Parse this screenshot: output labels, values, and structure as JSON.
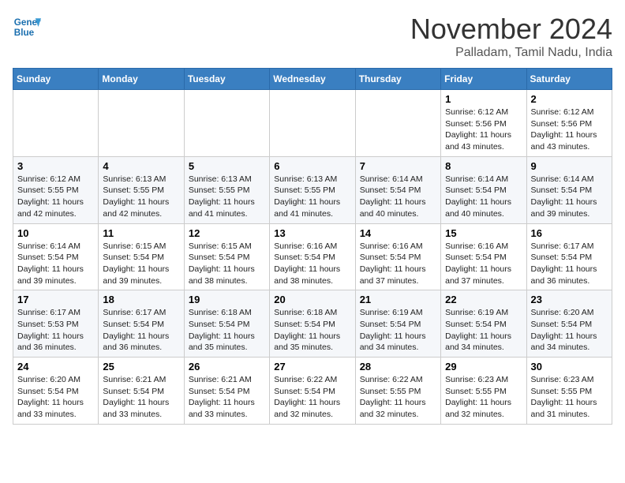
{
  "header": {
    "logo_line1": "General",
    "logo_line2": "Blue",
    "month": "November 2024",
    "location": "Palladam, Tamil Nadu, India"
  },
  "weekdays": [
    "Sunday",
    "Monday",
    "Tuesday",
    "Wednesday",
    "Thursday",
    "Friday",
    "Saturday"
  ],
  "weeks": [
    [
      {
        "day": "",
        "info": ""
      },
      {
        "day": "",
        "info": ""
      },
      {
        "day": "",
        "info": ""
      },
      {
        "day": "",
        "info": ""
      },
      {
        "day": "",
        "info": ""
      },
      {
        "day": "1",
        "info": "Sunrise: 6:12 AM\nSunset: 5:56 PM\nDaylight: 11 hours\nand 43 minutes."
      },
      {
        "day": "2",
        "info": "Sunrise: 6:12 AM\nSunset: 5:56 PM\nDaylight: 11 hours\nand 43 minutes."
      }
    ],
    [
      {
        "day": "3",
        "info": "Sunrise: 6:12 AM\nSunset: 5:55 PM\nDaylight: 11 hours\nand 42 minutes."
      },
      {
        "day": "4",
        "info": "Sunrise: 6:13 AM\nSunset: 5:55 PM\nDaylight: 11 hours\nand 42 minutes."
      },
      {
        "day": "5",
        "info": "Sunrise: 6:13 AM\nSunset: 5:55 PM\nDaylight: 11 hours\nand 41 minutes."
      },
      {
        "day": "6",
        "info": "Sunrise: 6:13 AM\nSunset: 5:55 PM\nDaylight: 11 hours\nand 41 minutes."
      },
      {
        "day": "7",
        "info": "Sunrise: 6:14 AM\nSunset: 5:54 PM\nDaylight: 11 hours\nand 40 minutes."
      },
      {
        "day": "8",
        "info": "Sunrise: 6:14 AM\nSunset: 5:54 PM\nDaylight: 11 hours\nand 40 minutes."
      },
      {
        "day": "9",
        "info": "Sunrise: 6:14 AM\nSunset: 5:54 PM\nDaylight: 11 hours\nand 39 minutes."
      }
    ],
    [
      {
        "day": "10",
        "info": "Sunrise: 6:14 AM\nSunset: 5:54 PM\nDaylight: 11 hours\nand 39 minutes."
      },
      {
        "day": "11",
        "info": "Sunrise: 6:15 AM\nSunset: 5:54 PM\nDaylight: 11 hours\nand 39 minutes."
      },
      {
        "day": "12",
        "info": "Sunrise: 6:15 AM\nSunset: 5:54 PM\nDaylight: 11 hours\nand 38 minutes."
      },
      {
        "day": "13",
        "info": "Sunrise: 6:16 AM\nSunset: 5:54 PM\nDaylight: 11 hours\nand 38 minutes."
      },
      {
        "day": "14",
        "info": "Sunrise: 6:16 AM\nSunset: 5:54 PM\nDaylight: 11 hours\nand 37 minutes."
      },
      {
        "day": "15",
        "info": "Sunrise: 6:16 AM\nSunset: 5:54 PM\nDaylight: 11 hours\nand 37 minutes."
      },
      {
        "day": "16",
        "info": "Sunrise: 6:17 AM\nSunset: 5:54 PM\nDaylight: 11 hours\nand 36 minutes."
      }
    ],
    [
      {
        "day": "17",
        "info": "Sunrise: 6:17 AM\nSunset: 5:53 PM\nDaylight: 11 hours\nand 36 minutes."
      },
      {
        "day": "18",
        "info": "Sunrise: 6:17 AM\nSunset: 5:54 PM\nDaylight: 11 hours\nand 36 minutes."
      },
      {
        "day": "19",
        "info": "Sunrise: 6:18 AM\nSunset: 5:54 PM\nDaylight: 11 hours\nand 35 minutes."
      },
      {
        "day": "20",
        "info": "Sunrise: 6:18 AM\nSunset: 5:54 PM\nDaylight: 11 hours\nand 35 minutes."
      },
      {
        "day": "21",
        "info": "Sunrise: 6:19 AM\nSunset: 5:54 PM\nDaylight: 11 hours\nand 34 minutes."
      },
      {
        "day": "22",
        "info": "Sunrise: 6:19 AM\nSunset: 5:54 PM\nDaylight: 11 hours\nand 34 minutes."
      },
      {
        "day": "23",
        "info": "Sunrise: 6:20 AM\nSunset: 5:54 PM\nDaylight: 11 hours\nand 34 minutes."
      }
    ],
    [
      {
        "day": "24",
        "info": "Sunrise: 6:20 AM\nSunset: 5:54 PM\nDaylight: 11 hours\nand 33 minutes."
      },
      {
        "day": "25",
        "info": "Sunrise: 6:21 AM\nSunset: 5:54 PM\nDaylight: 11 hours\nand 33 minutes."
      },
      {
        "day": "26",
        "info": "Sunrise: 6:21 AM\nSunset: 5:54 PM\nDaylight: 11 hours\nand 33 minutes."
      },
      {
        "day": "27",
        "info": "Sunrise: 6:22 AM\nSunset: 5:54 PM\nDaylight: 11 hours\nand 32 minutes."
      },
      {
        "day": "28",
        "info": "Sunrise: 6:22 AM\nSunset: 5:55 PM\nDaylight: 11 hours\nand 32 minutes."
      },
      {
        "day": "29",
        "info": "Sunrise: 6:23 AM\nSunset: 5:55 PM\nDaylight: 11 hours\nand 32 minutes."
      },
      {
        "day": "30",
        "info": "Sunrise: 6:23 AM\nSunset: 5:55 PM\nDaylight: 11 hours\nand 31 minutes."
      }
    ]
  ]
}
